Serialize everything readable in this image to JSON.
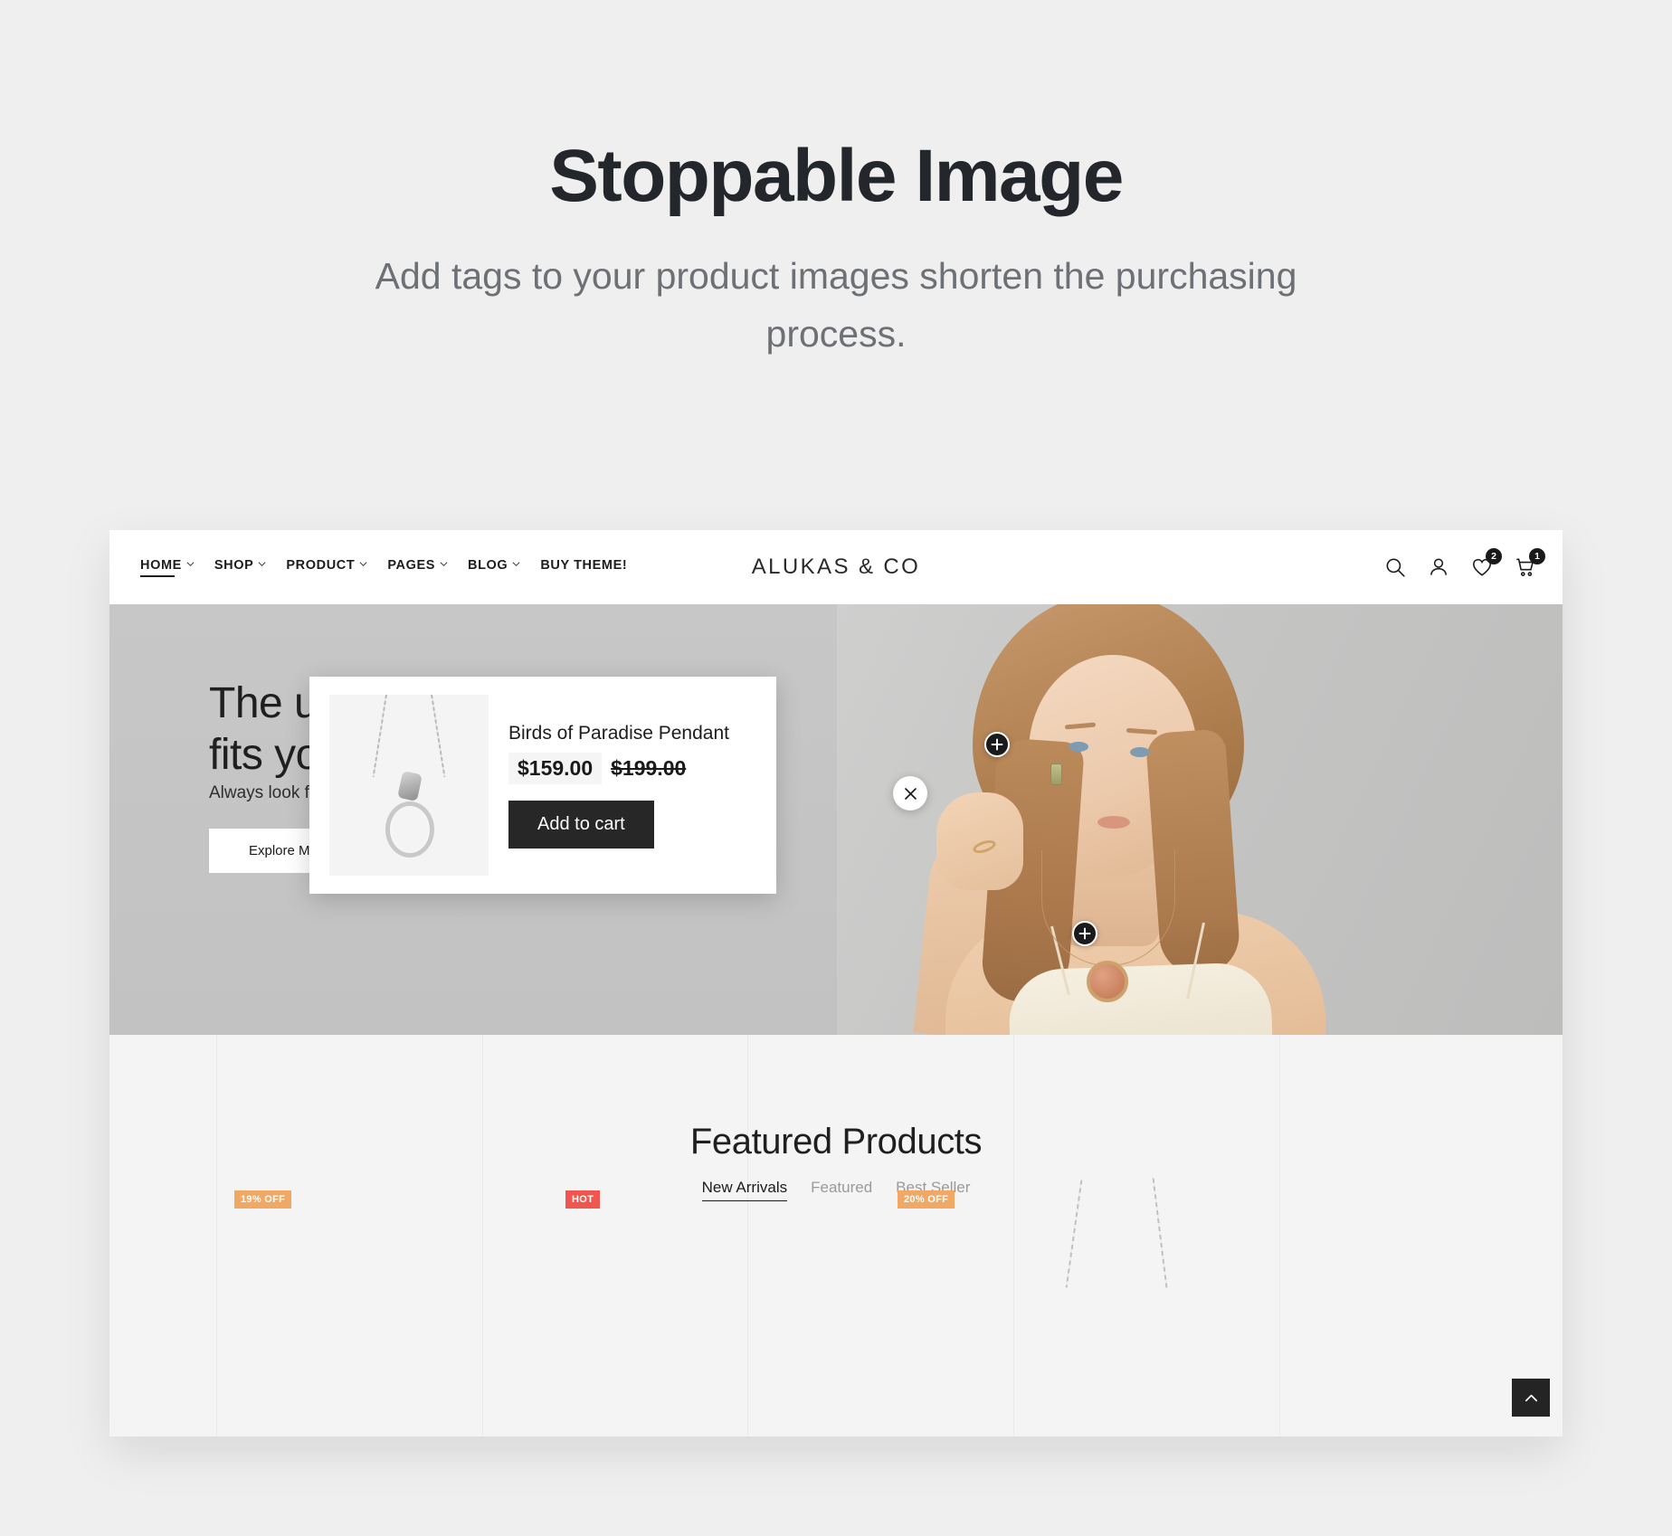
{
  "promo": {
    "title": "Stoppable Image",
    "subtitle": "Add tags to your product images shorten the purchasing process."
  },
  "site": {
    "brand": "ALUKAS & CO",
    "nav": [
      {
        "label": "HOME",
        "has_dropdown": true,
        "active": true
      },
      {
        "label": "SHOP",
        "has_dropdown": true,
        "active": false
      },
      {
        "label": "PRODUCT",
        "has_dropdown": true,
        "active": false
      },
      {
        "label": "PAGES",
        "has_dropdown": true,
        "active": false
      },
      {
        "label": "BLOG",
        "has_dropdown": true,
        "active": false
      },
      {
        "label": "BUY THEME!",
        "has_dropdown": false,
        "active": false
      }
    ],
    "icons": [
      {
        "name": "search-icon",
        "badge": ""
      },
      {
        "name": "account-icon",
        "badge": ""
      },
      {
        "name": "wishlist-heart-icon",
        "badge": "2"
      },
      {
        "name": "cart-icon",
        "badge": "1"
      }
    ]
  },
  "hero": {
    "heading": "The u\nfits yo",
    "paragraph": "Always look for",
    "button": "Explore More",
    "hotspots": [
      {
        "name": "hotspot-earring",
        "icon": "plus-icon"
      },
      {
        "name": "hotspot-necklace",
        "icon": "plus-icon"
      }
    ],
    "close_button": {
      "name": "close-popup-button",
      "icon": "close-icon"
    }
  },
  "popup": {
    "product_title": "Birds of Paradise Pendant",
    "price": "$159.00",
    "price_old": "$199.00",
    "add_to_cart": "Add to cart",
    "thumbnail_alt": "pendant-necklace-thumbnail"
  },
  "featured": {
    "title": "Featured Products",
    "tabs": [
      {
        "label": "New Arrivals",
        "active": true
      },
      {
        "label": "Featured",
        "active": false
      },
      {
        "label": "Best Seller",
        "active": false
      }
    ],
    "product_badges": [
      {
        "label": "19% OFF",
        "color": "#f0a864"
      },
      {
        "label": "HOT",
        "color": "#f0554e"
      },
      {
        "label": "20% OFF",
        "color": "#f0a864"
      }
    ]
  },
  "scroll_to_top": {
    "name": "scroll-to-top-button",
    "icon": "chevron-up-icon"
  },
  "colors": {
    "page_bg": "#efefef",
    "dark": "#1a1a1a",
    "featured_bg": "#f4f4f4",
    "badge_orange": "#f0a864",
    "badge_red": "#f0554e"
  }
}
